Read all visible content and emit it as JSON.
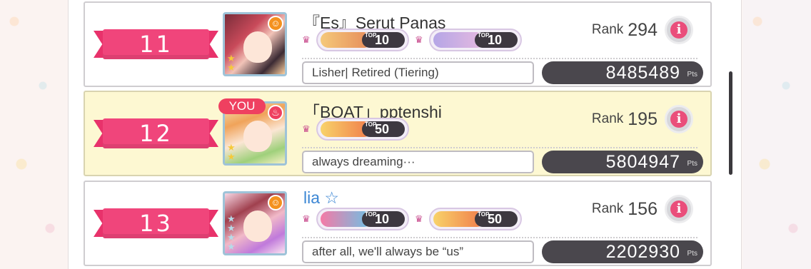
{
  "colors": {
    "banner": "#e8326b",
    "you_bg": "#fdf8d2",
    "name_blue": "#3b86d4",
    "pts_bg": "#4a474d"
  },
  "rows": [
    {
      "rank": "11",
      "name": "『Es』Serut Panas",
      "attribute_icon": "happy-face-icon",
      "level_label": "Rank",
      "level": "294",
      "comment": "Lisher| Retired (Tiering)",
      "points": "8485489",
      "points_unit": "Pts",
      "badges": [
        {
          "top_label": "TOP",
          "top": "10",
          "color": "#e6a24a"
        },
        {
          "top_label": "TOP",
          "top": "10",
          "color": "#c79be0"
        }
      ]
    },
    {
      "rank": "12",
      "you_tag": "YOU",
      "name": "「BOAT」pptenshi",
      "attribute_icon": "fire-icon",
      "level_label": "Rank",
      "level": "195",
      "comment": "always dreaming···",
      "points": "5804947",
      "points_unit": "Pts",
      "badges": [
        {
          "top_label": "TOP",
          "top": "50",
          "color": "#f08a56"
        }
      ]
    },
    {
      "rank": "13",
      "name": "lia ☆",
      "attribute_icon": "happy-face-icon",
      "level_label": "Rank",
      "level": "156",
      "comment": "after all, we'll always be “us”",
      "points": "2202930",
      "points_unit": "Pts",
      "badges": [
        {
          "top_label": "TOP",
          "top": "10",
          "color": "#ef6a9a"
        },
        {
          "top_label": "TOP",
          "top": "50",
          "color": "#f08a56"
        }
      ]
    }
  ]
}
